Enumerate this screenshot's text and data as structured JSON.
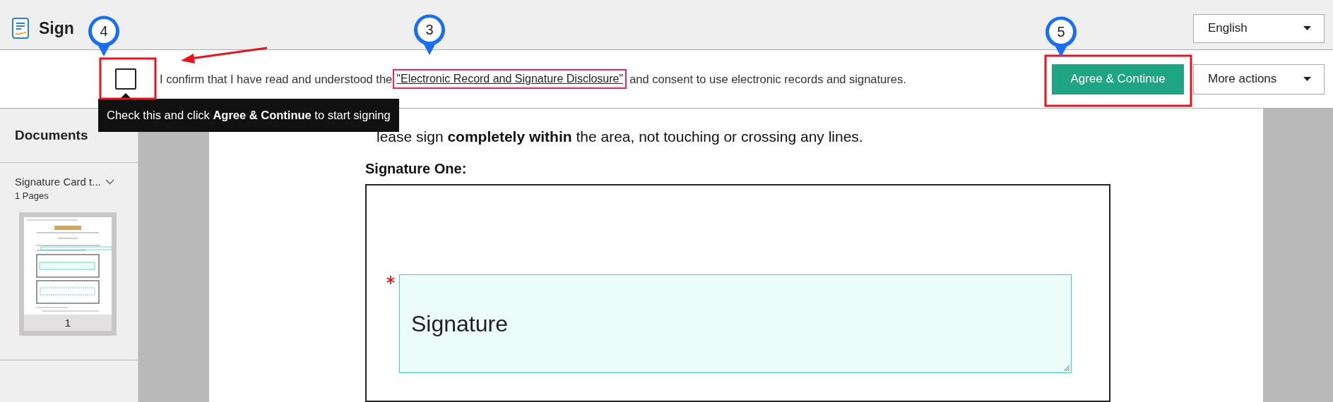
{
  "header": {
    "title": "Sign",
    "language": "English"
  },
  "consent": {
    "checked": false,
    "text_before": "I confirm that I have read and understood the",
    "link": "\"Electronic Record and Signature Disclosure\"",
    "text_after": "and consent to use electronic records and signatures.",
    "primary_button": "Agree & Continue",
    "menu_button": "More actions"
  },
  "tooltip": {
    "text": "Check this and click **Agree & Continue** to start signing"
  },
  "sidebar": {
    "title": "Documents",
    "documents": [
      {
        "name": "Signature Card t...",
        "pages": "1 Pages",
        "page_number": "1"
      }
    ]
  },
  "document": {
    "instruction": "lease sign **completely within** the area, not touching or crossing any lines.",
    "section_title": "Signature One:",
    "fields": [
      {
        "label": "Signature",
        "required": true
      }
    ]
  },
  "annotations": [
    {
      "number": "4"
    },
    {
      "number": "3"
    },
    {
      "number": "5"
    }
  ]
}
